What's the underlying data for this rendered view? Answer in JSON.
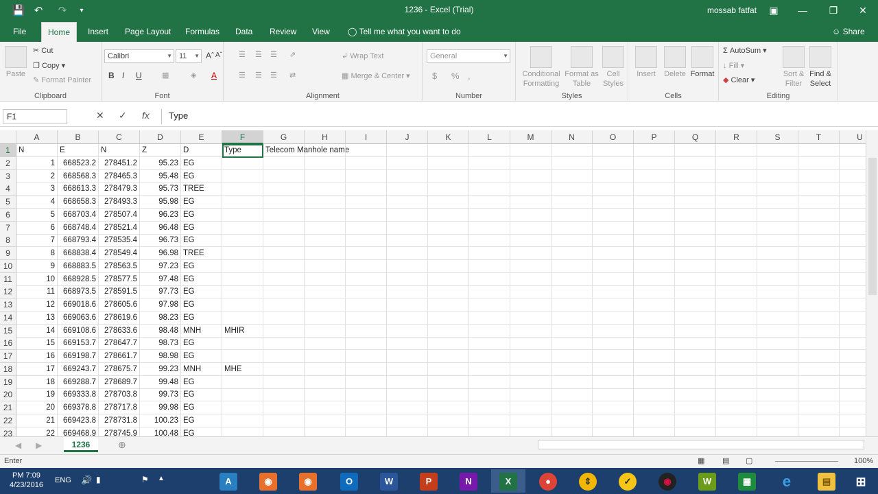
{
  "window": {
    "title": "1236 - Excel (Trial)",
    "user": "mossab fatfat",
    "accent": "#217346"
  },
  "tabs": [
    "File",
    "Home",
    "Insert",
    "Page Layout",
    "Formulas",
    "Data",
    "Review",
    "View"
  ],
  "tell_me": "Tell me what you want to do",
  "share": "Share",
  "ribbon": {
    "clipboard": {
      "label": "Clipboard",
      "paste": "Paste",
      "cut": "Cut",
      "copy": "Copy",
      "format_painter": "Format Painter"
    },
    "font": {
      "label": "Font",
      "family": "Calibri",
      "size": "11"
    },
    "alignment": {
      "label": "Alignment",
      "wrap": "Wrap Text",
      "merge": "Merge & Center"
    },
    "number": {
      "label": "Number",
      "format": "General"
    },
    "styles": {
      "label": "Styles",
      "conditional": "Conditional",
      "conditional2": "Formatting",
      "format_as": "Format as",
      "format_as2": "Table",
      "cell": "Cell",
      "cell2": "Styles"
    },
    "cells": {
      "label": "Cells",
      "insert": "Insert",
      "delete": "Delete",
      "format": "Format"
    },
    "editing": {
      "label": "Editing",
      "autosum": "AutoSum",
      "fill": "Fill",
      "clear": "Clear",
      "sort": "Sort &",
      "sort2": "Filter",
      "find": "Find &",
      "find2": "Select"
    }
  },
  "formula_bar": {
    "name_box": "F1",
    "content": "Type"
  },
  "columns": [
    "A",
    "B",
    "C",
    "D",
    "E",
    "F",
    "G",
    "H",
    "I",
    "J",
    "K",
    "L",
    "M",
    "N",
    "O",
    "P",
    "Q",
    "R",
    "S",
    "T",
    "U"
  ],
  "rows": [
    {
      "n": "1",
      "A": "N",
      "B": "E",
      "C": "N",
      "D": "Z",
      "E": "D",
      "F": "Type",
      "G": "Telecom Manhole name"
    },
    {
      "n": "2",
      "A": "1",
      "B": "668523.2",
      "C": "278451.2",
      "D": "95.23",
      "E": "EG",
      "F": ""
    },
    {
      "n": "3",
      "A": "2",
      "B": "668568.3",
      "C": "278465.3",
      "D": "95.48",
      "E": "EG",
      "F": ""
    },
    {
      "n": "4",
      "A": "3",
      "B": "668613.3",
      "C": "278479.3",
      "D": "95.73",
      "E": "TREE",
      "F": ""
    },
    {
      "n": "5",
      "A": "4",
      "B": "668658.3",
      "C": "278493.3",
      "D": "95.98",
      "E": "EG",
      "F": ""
    },
    {
      "n": "6",
      "A": "5",
      "B": "668703.4",
      "C": "278507.4",
      "D": "96.23",
      "E": "EG",
      "F": ""
    },
    {
      "n": "7",
      "A": "6",
      "B": "668748.4",
      "C": "278521.4",
      "D": "96.48",
      "E": "EG",
      "F": ""
    },
    {
      "n": "8",
      "A": "7",
      "B": "668793.4",
      "C": "278535.4",
      "D": "96.73",
      "E": "EG",
      "F": ""
    },
    {
      "n": "9",
      "A": "8",
      "B": "668838.4",
      "C": "278549.4",
      "D": "96.98",
      "E": "TREE",
      "F": ""
    },
    {
      "n": "10",
      "A": "9",
      "B": "668883.5",
      "C": "278563.5",
      "D": "97.23",
      "E": "EG",
      "F": ""
    },
    {
      "n": "11",
      "A": "10",
      "B": "668928.5",
      "C": "278577.5",
      "D": "97.48",
      "E": "EG",
      "F": ""
    },
    {
      "n": "12",
      "A": "11",
      "B": "668973.5",
      "C": "278591.5",
      "D": "97.73",
      "E": "EG",
      "F": ""
    },
    {
      "n": "13",
      "A": "12",
      "B": "669018.6",
      "C": "278605.6",
      "D": "97.98",
      "E": "EG",
      "F": ""
    },
    {
      "n": "14",
      "A": "13",
      "B": "669063.6",
      "C": "278619.6",
      "D": "98.23",
      "E": "EG",
      "F": ""
    },
    {
      "n": "15",
      "A": "14",
      "B": "669108.6",
      "C": "278633.6",
      "D": "98.48",
      "E": "MNH",
      "F": "MHIR"
    },
    {
      "n": "16",
      "A": "15",
      "B": "669153.7",
      "C": "278647.7",
      "D": "98.73",
      "E": "EG",
      "F": ""
    },
    {
      "n": "17",
      "A": "16",
      "B": "669198.7",
      "C": "278661.7",
      "D": "98.98",
      "E": "EG",
      "F": ""
    },
    {
      "n": "18",
      "A": "17",
      "B": "669243.7",
      "C": "278675.7",
      "D": "99.23",
      "E": "MNH",
      "F": "MHE"
    },
    {
      "n": "19",
      "A": "18",
      "B": "669288.7",
      "C": "278689.7",
      "D": "99.48",
      "E": "EG",
      "F": ""
    },
    {
      "n": "20",
      "A": "19",
      "B": "669333.8",
      "C": "278703.8",
      "D": "99.73",
      "E": "EG",
      "F": ""
    },
    {
      "n": "21",
      "A": "20",
      "B": "669378.8",
      "C": "278717.8",
      "D": "99.98",
      "E": "EG",
      "F": ""
    },
    {
      "n": "22",
      "A": "21",
      "B": "669423.8",
      "C": "278731.8",
      "D": "100.23",
      "E": "EG",
      "F": ""
    },
    {
      "n": "23",
      "A": "22",
      "B": "669468.9",
      "C": "278745.9",
      "D": "100.48",
      "E": "EG",
      "F": ""
    }
  ],
  "sheet_tab": "1236",
  "status": {
    "mode": "Enter",
    "zoom": "100%"
  },
  "taskbar": {
    "time": "PM 7:09",
    "date": "4/23/2016",
    "lang": "ENG"
  }
}
